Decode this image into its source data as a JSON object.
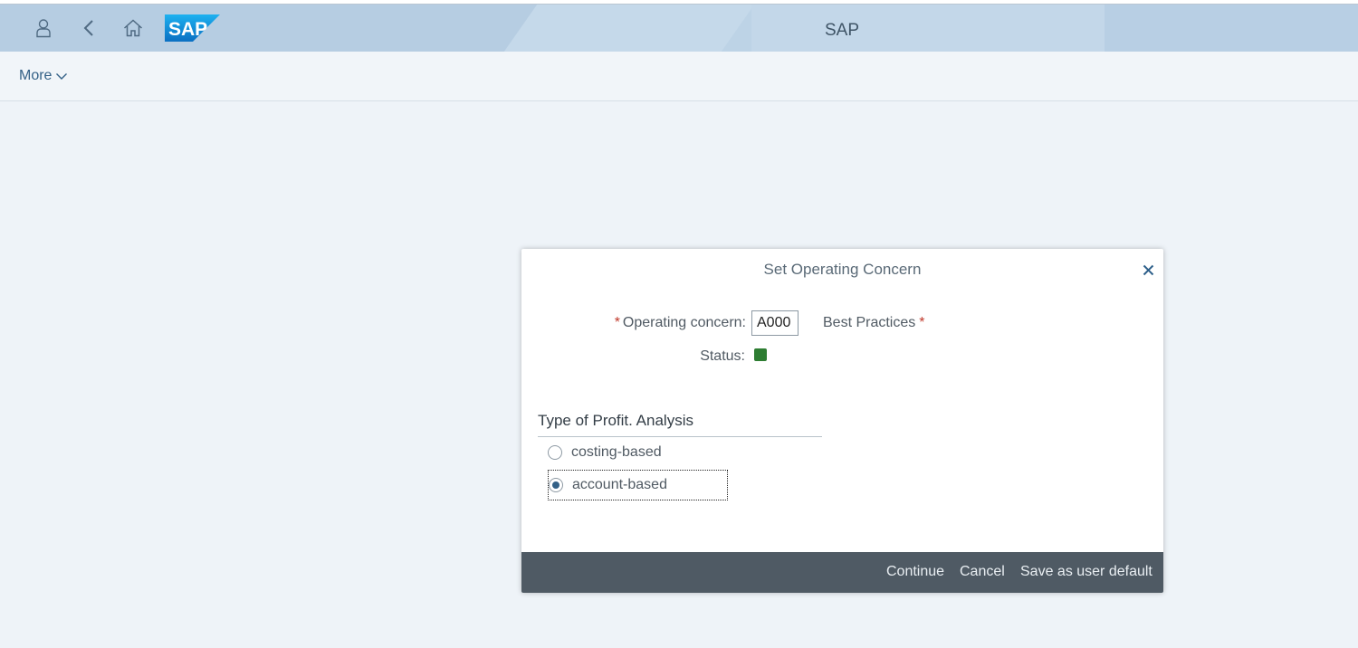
{
  "shell": {
    "title": "SAP",
    "logo_text": "SAP",
    "icons": {
      "profile": "user-icon",
      "back": "back-icon",
      "home": "home-icon"
    }
  },
  "toolbar": {
    "more_label": "More"
  },
  "dialog": {
    "title": "Set Operating Concern",
    "operating_concern_label": "Operating concern:",
    "operating_concern_value": "A000",
    "operating_concern_description": "Best Practices",
    "status_label": "Status:",
    "status_color": "#2e7d32",
    "group_title": "Type of Profit. Analysis",
    "options": [
      {
        "label": "costing-based",
        "selected": false
      },
      {
        "label": "account-based",
        "selected": true
      }
    ],
    "buttons": {
      "continue": "Continue",
      "cancel": "Cancel",
      "save_default": "Save as user default"
    }
  },
  "colors": {
    "shell_bg": "#bdd3e6",
    "footer_bg": "#4f5a64",
    "required": "#c0392b",
    "link": "#346187"
  }
}
